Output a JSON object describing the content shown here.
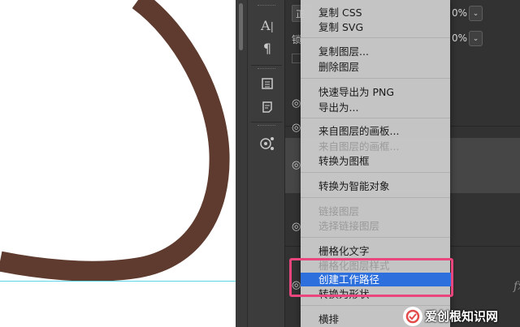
{
  "menu": {
    "items": [
      {
        "label": "复制 CSS",
        "enabled": true
      },
      {
        "label": "复制 SVG",
        "enabled": true
      },
      {
        "label": "复制图层...",
        "enabled": true
      },
      {
        "label": "删除图层",
        "enabled": true
      },
      {
        "label": "快速导出为 PNG",
        "enabled": true
      },
      {
        "label": "导出为...",
        "enabled": true
      },
      {
        "label": "来自图层的画板...",
        "enabled": true
      },
      {
        "label": "来自图层的画框...",
        "enabled": false
      },
      {
        "label": "转换为图框",
        "enabled": true
      },
      {
        "label": "转换为智能对象",
        "enabled": true
      },
      {
        "label": "链接图层",
        "enabled": false
      },
      {
        "label": "选择链接图层",
        "enabled": false
      },
      {
        "label": "栅格化文字",
        "enabled": true
      },
      {
        "label": "栅格化图层样式",
        "enabled": false
      },
      {
        "label": "创建工作路径",
        "enabled": true,
        "selected": true
      },
      {
        "label": "转换为形状",
        "enabled": true
      },
      {
        "label": "横排",
        "enabled": true
      }
    ],
    "highlight_color": "#e8467c",
    "selected_color": "#2d6fdc"
  },
  "layers_panel": {
    "opacity_value": "0%",
    "fill_value": "0%",
    "mode_partial": "正",
    "lock_label": "锁",
    "fx_label": "fx"
  },
  "tools": [
    {
      "name": "character-icon",
      "glyph": "A|"
    },
    {
      "name": "paragraph-icon",
      "glyph": "¶"
    },
    {
      "name": "libraries-icon",
      "glyph": "▤"
    },
    {
      "name": "notes-icon",
      "glyph": "☰"
    },
    {
      "name": "adjust-icon",
      "glyph": "◎"
    }
  ],
  "canvas": {
    "stroke_color": "#5e3b2e",
    "guide_color": "#5fd6e8"
  },
  "watermark": {
    "text": "爱创根知识网"
  }
}
